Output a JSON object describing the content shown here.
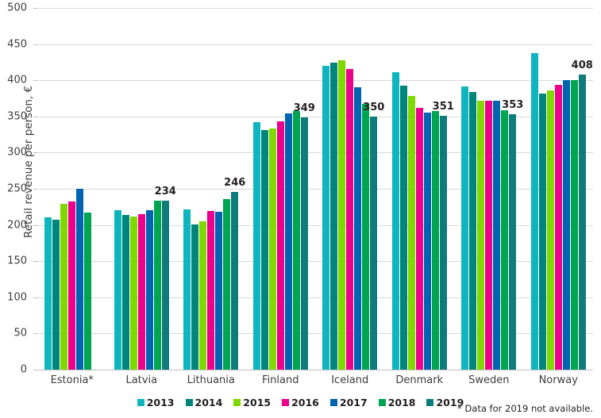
{
  "chart_data": {
    "type": "bar",
    "title": "",
    "subtitle": "",
    "xlabel": "",
    "ylabel": "Retail revenue per person, €",
    "ylim": [
      0,
      500
    ],
    "ytick_step": 50,
    "yticks": [
      "500",
      "450",
      "400",
      "350",
      "300",
      "250",
      "200",
      "150",
      "100",
      "50",
      "0"
    ],
    "grid": true,
    "legend_position": "bottom",
    "categories": [
      "Estonia*",
      "Latvia",
      "Lithuania",
      "Finland",
      "Iceland",
      "Denmark",
      "Sweden",
      "Norway"
    ],
    "series": [
      {
        "name": "2013",
        "color": "#0FB5BE",
        "values": [
          210,
          220,
          221,
          342,
          420,
          411,
          392,
          437
        ]
      },
      {
        "name": "2014",
        "color": "#00857D",
        "values": [
          207,
          214,
          201,
          331,
          424,
          393,
          384,
          382
        ]
      },
      {
        "name": "2015",
        "color": "#7FD800",
        "values": [
          229,
          212,
          205,
          333,
          428,
          378,
          372,
          386
        ]
      },
      {
        "name": "2016",
        "color": "#EC008C",
        "values": [
          233,
          215,
          219,
          343,
          416,
          362,
          372,
          394
        ]
      },
      {
        "name": "2017",
        "color": "#0064B0",
        "values": [
          250,
          220,
          218,
          354,
          390,
          355,
          372,
          400
        ]
      },
      {
        "name": "2018",
        "color": "#00A551",
        "values": [
          217,
          234,
          236,
          357,
          367,
          357,
          359,
          400
        ]
      },
      {
        "name": "2019",
        "color": "#0E7C7B",
        "values": [
          null,
          234,
          246,
          349,
          350,
          351,
          353,
          408
        ]
      }
    ],
    "data_labels": [
      {
        "category": "Latvia",
        "series": "2019",
        "text": "234"
      },
      {
        "category": "Lithuania",
        "series": "2019",
        "text": "246"
      },
      {
        "category": "Finland",
        "series": "2019",
        "text": "349"
      },
      {
        "category": "Iceland",
        "series": "2019",
        "text": "350"
      },
      {
        "category": "Denmark",
        "series": "2019",
        "text": "351"
      },
      {
        "category": "Sweden",
        "series": "2019",
        "text": "353"
      },
      {
        "category": "Norway",
        "series": "2019",
        "text": "408"
      }
    ],
    "annotations": [
      {
        "name": "footnote",
        "text": "* Data for 2019 not available."
      }
    ]
  }
}
